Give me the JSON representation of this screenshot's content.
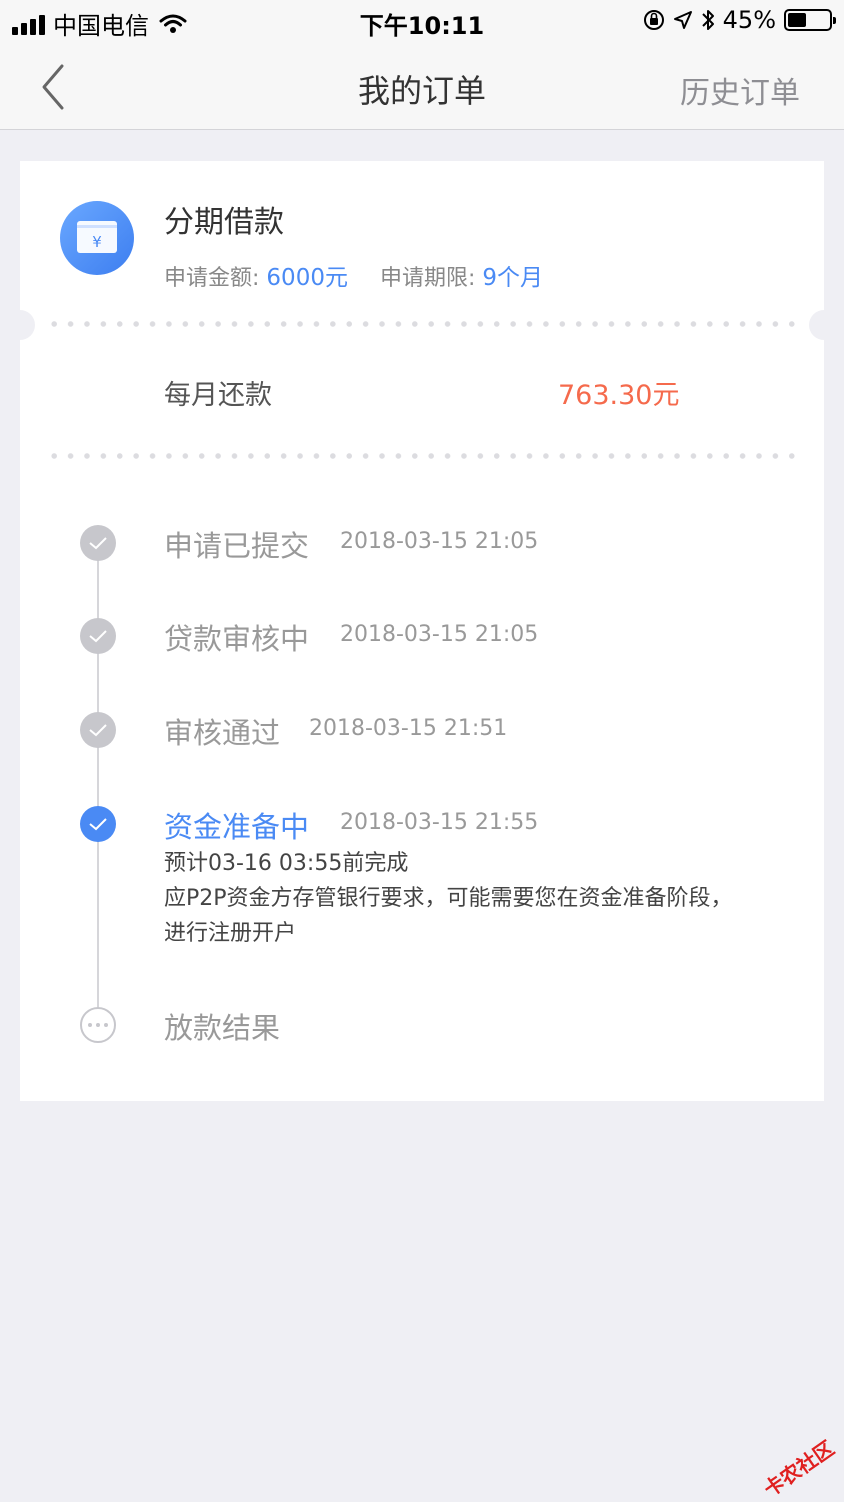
{
  "status_bar": {
    "carrier": "中国电信",
    "time": "下午10:11",
    "battery": "45%",
    "battery_level": 0.45
  },
  "nav": {
    "title": "我的订单",
    "history_label": "历史订单"
  },
  "loan": {
    "title": "分期借款",
    "amount_label": "申请金额:",
    "amount_value": "6000元",
    "term_label": "申请期限:",
    "term_value": "9个月",
    "monthly_label": "每月还款",
    "monthly_value": "763.30元",
    "icon_symbol": "¥"
  },
  "timeline": [
    {
      "title": "申请已提交",
      "time": "2018-03-15 21:05",
      "state": "done"
    },
    {
      "title": "贷款审核中",
      "time": "2018-03-15 21:05",
      "state": "done"
    },
    {
      "title": "审核通过",
      "time": "2018-03-15 21:51",
      "state": "done"
    },
    {
      "title": "资金准备中",
      "time": "2018-03-15 21:55",
      "state": "active",
      "desc1": "预计03-16 03:55前完成",
      "desc2": "应P2P资金方存管银行要求，可能需要您在资金准备阶段，进行注册开户"
    },
    {
      "title": "放款结果",
      "time": "",
      "state": "pending"
    }
  ],
  "watermark": "卡农社区",
  "colors": {
    "accent": "#4a8af4",
    "amount_red": "#f56a4c",
    "done_gray": "#c7c7cc",
    "background": "#efeff4"
  }
}
